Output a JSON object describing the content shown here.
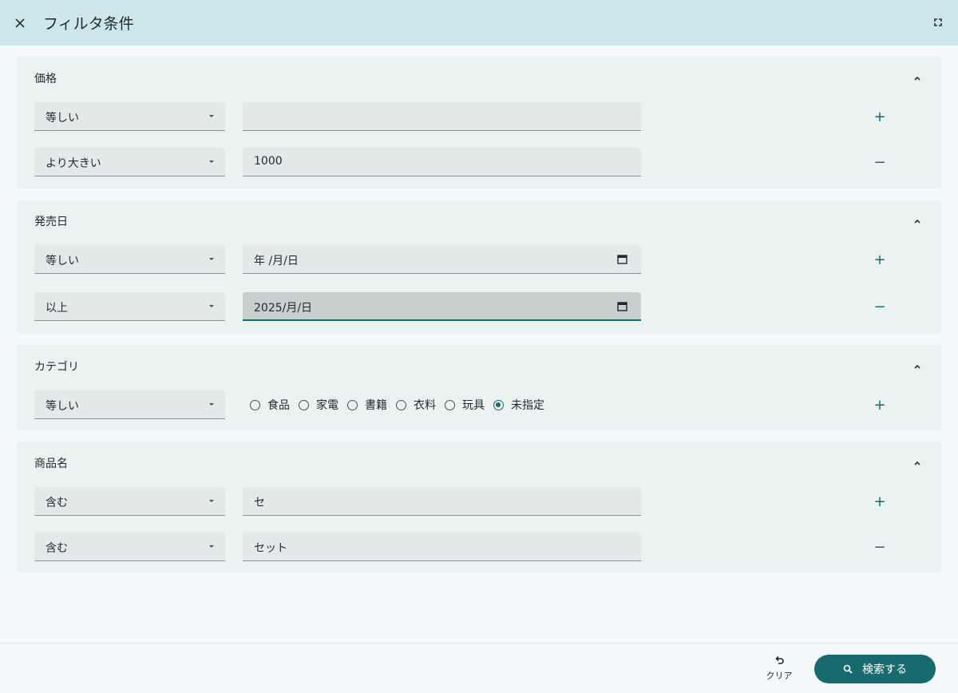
{
  "header": {
    "title": "フィルタ条件",
    "close_icon": "close-icon",
    "fullscreen_icon": "fullscreen-icon"
  },
  "colors": {
    "accent": "#176a6e",
    "header_bg": "#cde6ea",
    "section_bg": "#ebf2f2"
  },
  "sections": [
    {
      "title": "価格",
      "rows": [
        {
          "operator": "等しい",
          "value": "",
          "action": "+"
        },
        {
          "operator": "より大きい",
          "value": "1000",
          "action": "−"
        }
      ]
    },
    {
      "title": "発売日",
      "rows": [
        {
          "operator": "等しい",
          "value": " 年 /月/日",
          "action": "+"
        },
        {
          "operator": "以上",
          "value": "2025/月/日",
          "action": "−"
        }
      ]
    },
    {
      "title": "カテゴリ",
      "rows": [
        {
          "operator": "等しい",
          "action": "+",
          "options": [
            "食品",
            "家電",
            "書籍",
            "衣料",
            "玩具",
            "未指定"
          ],
          "selected": "未指定"
        }
      ]
    },
    {
      "title": "商品名",
      "rows": [
        {
          "operator": "含む",
          "value": "セ",
          "action": "+"
        },
        {
          "operator": "含む",
          "value": "セット",
          "action": "−"
        }
      ]
    }
  ],
  "footer": {
    "clear_label": "クリア",
    "search_label": "検索する",
    "clear_icon": "undo-icon",
    "search_icon": "search-icon"
  }
}
